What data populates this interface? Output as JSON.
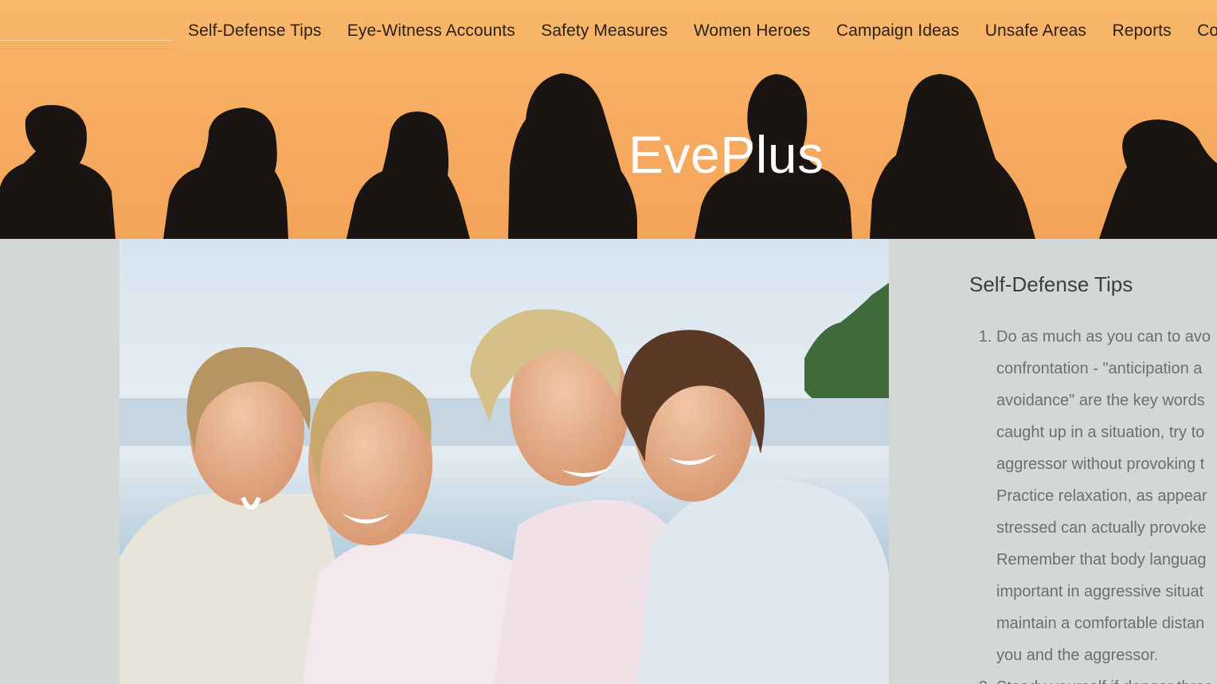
{
  "nav": {
    "items": [
      {
        "label": "Self-Defense Tips"
      },
      {
        "label": "Eye-Witness Accounts"
      },
      {
        "label": "Safety Measures"
      },
      {
        "label": "Women Heroes"
      },
      {
        "label": "Campaign Ideas"
      },
      {
        "label": "Unsafe Areas"
      },
      {
        "label": "Reports"
      },
      {
        "label": "Contac"
      }
    ]
  },
  "header": {
    "site_title": "EvePlus"
  },
  "sidebar": {
    "heading": "Self-Defense Tips",
    "tips": [
      {
        "lines": [
          "Do as much as you can to avo",
          "confrontation - \"anticipation a",
          "avoidance\" are the key words",
          "caught up in a situation, try to",
          "aggressor without provoking t",
          "Practice relaxation, as appear",
          "stressed can actually provoke",
          "Remember that body languag",
          "important in aggressive situat",
          "maintain a comfortable distan",
          "you and the aggressor."
        ]
      },
      {
        "lines": [
          "Steady yourself if danger threa"
        ]
      }
    ]
  },
  "colors": {
    "hero_top": "#f9b86b",
    "hero_bottom": "#f4a45a",
    "silhouette": "#1a1512",
    "page_bg": "#d3d8d4",
    "nav_text": "#2a2118",
    "title_text": "#ffffff",
    "body_text": "#6b6f6d"
  }
}
